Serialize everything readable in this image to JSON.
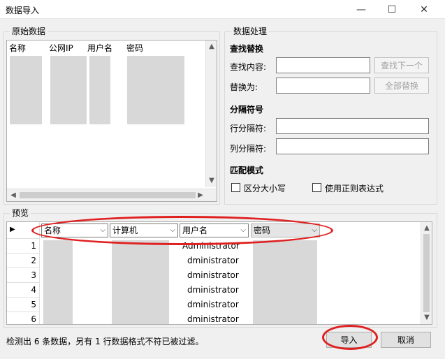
{
  "window": {
    "title": "数据导入",
    "minimize": "—",
    "maximize": "☐",
    "close": "✕"
  },
  "source": {
    "group_label": "原始数据",
    "columns": [
      "名称",
      "公网IP",
      "用户名",
      "密码"
    ]
  },
  "processing": {
    "group_label": "数据处理",
    "find_replace": {
      "title": "查找替换",
      "find_label": "查找内容:",
      "find_value": "",
      "replace_label": "替换为:",
      "replace_value": "",
      "find_next_button": "查找下一个",
      "replace_all_button": "全部替换"
    },
    "separator": {
      "title": "分隔符号",
      "row_label": "行分隔符:",
      "row_value": "",
      "col_label": "列分隔符:",
      "col_value": ""
    },
    "match": {
      "title": "匹配模式",
      "case_label": "区分大小写",
      "regex_label": "使用正则表达式"
    }
  },
  "preview": {
    "group_label": "预览",
    "header_marker": "▶",
    "columns": [
      "名称",
      "计算机",
      "用户名",
      "密码"
    ],
    "row_numbers": [
      "1",
      "2",
      "3",
      "4",
      "5",
      "6"
    ],
    "user_values": [
      "Administrator",
      "dministrator",
      "dministrator",
      "dministrator",
      "dministrator",
      "dministrator"
    ]
  },
  "status_text": "检测出 6 条数据，另有 1 行数据格式不符已被过滤。",
  "buttons": {
    "import": "导入",
    "cancel": "取消"
  },
  "colors": {
    "annotation": "#e02020"
  }
}
